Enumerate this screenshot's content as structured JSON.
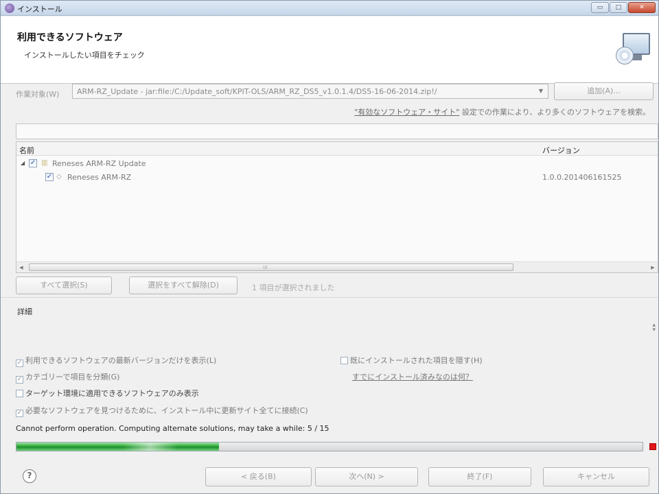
{
  "window": {
    "title": "インストール",
    "controls": [
      "▭",
      "□",
      "✕"
    ]
  },
  "header": {
    "title": "利用できるソフトウェア",
    "subtitle": "インストールしたい項目をチェック"
  },
  "work_with": {
    "label": "作業対象(W)",
    "value": "ARM-RZ_Update - jar:file:/C:/Update_soft/KPIT-OLS/ARM_RZ_DS5_v1.0.1.4/DS5-16-06-2014.zip!/",
    "add_button": "追加(A)...",
    "find_more_link": "\"有効なソフトウェア・サイト\"",
    "find_more_rest": " 設定での作業により、より多くのソフトウェアを検索。"
  },
  "filter": {
    "value": ""
  },
  "tree": {
    "columns": {
      "name": "名前",
      "version": "バージョン"
    },
    "rows": [
      {
        "label": "Reneses ARM-RZ Update",
        "version": "",
        "checked": true,
        "level": 0
      },
      {
        "label": "Reneses ARM-RZ",
        "version": "1.0.0.201406161525",
        "checked": true,
        "level": 1
      }
    ]
  },
  "selection": {
    "select_all": "すべて選択(S)",
    "deselect_all": "選択をすべて解除(D)",
    "count_text": "1 項目が選択されました"
  },
  "details": {
    "label": "詳細"
  },
  "options": {
    "latest_only": "利用できるソフトウェアの最新バージョンだけを表示(L)",
    "group_by_category": "カテゴリーで項目を分類(G)",
    "target_only": "ターゲット環境に適用できるソフトウェアのみ表示",
    "contact_all": "必要なソフトウェアを見つけるために、インストール中に更新サイト全てに接続(C)",
    "hide_installed": "既にインストールされた項目を隠す(H)",
    "already_installed_link": "すでにインストール済みなのは何？"
  },
  "status": {
    "text": "Cannot perform operation. Computing alternate solutions, may take a while: 5 / 15",
    "progress": 0.323
  },
  "footer": {
    "help": "?",
    "back": "< 戻る(B)",
    "next": "次へ(N) >",
    "finish": "終了(F)",
    "cancel": "キャンセル"
  },
  "colors": {
    "progress_green": "#2ea83a",
    "stop_red": "#e0161b"
  }
}
